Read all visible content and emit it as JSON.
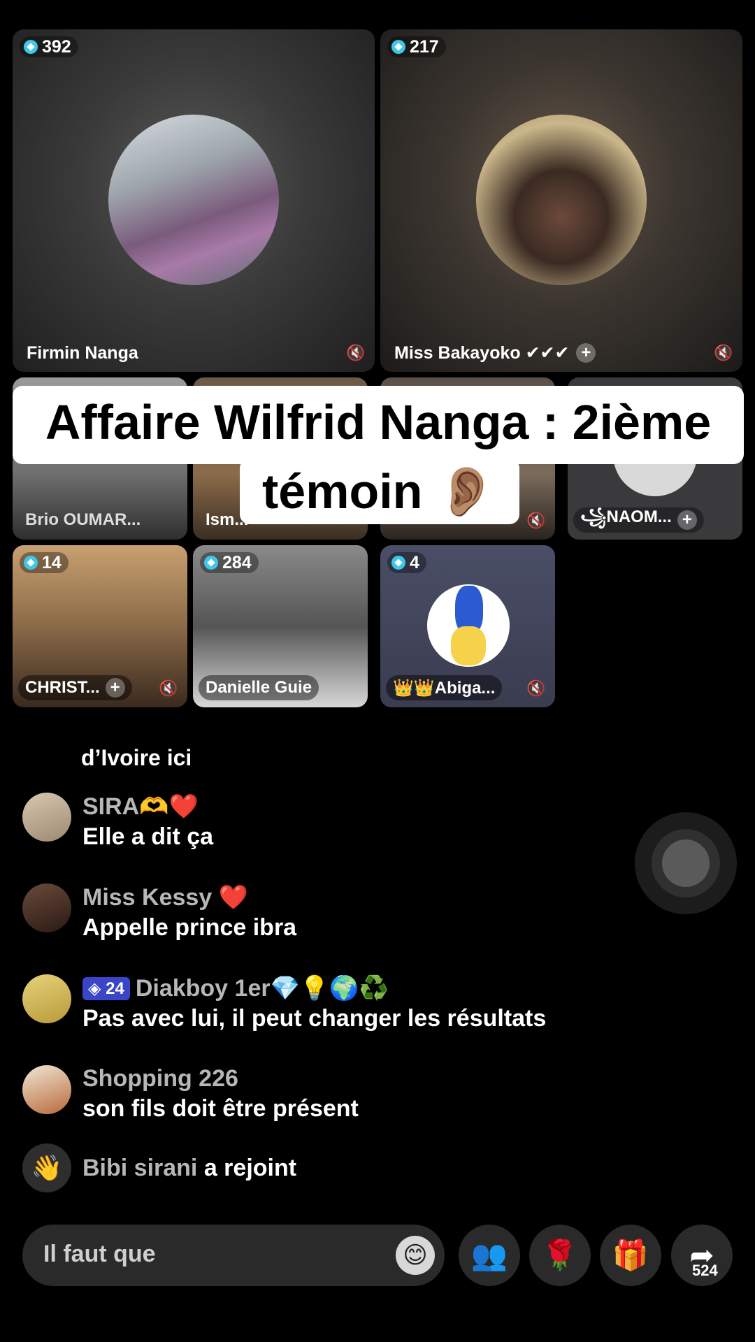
{
  "tiles": [
    {
      "viewers": "392",
      "name": "Firmin Nanga"
    },
    {
      "viewers": "217",
      "name": "Miss Bakayoko ✔✔✔"
    },
    {
      "name": "Brio OUMAR..."
    },
    {
      "name": "Ism..."
    },
    {
      "name": ""
    },
    {
      "name": "꧁NAOM..."
    },
    {
      "viewers": "14",
      "name": "CHRIST..."
    },
    {
      "viewers": "284",
      "name": "Danielle Guie"
    },
    {
      "viewers": "4",
      "name": "👑👑Abiga..."
    }
  ],
  "overlay": {
    "line1": "Affaire Wilfrid Nanga : 2ième",
    "line2": "témoin 👂🏽"
  },
  "chat": {
    "partial_text": "d’Ivoire ici",
    "messages": [
      {
        "user": "SIRA🫶❤️",
        "text": "Elle a dit ça"
      },
      {
        "user": "Miss Kessy ❤️",
        "text": "Appelle prince ibra"
      },
      {
        "level": "24",
        "user": "Diakboy 1er💎💡🌍♻️",
        "text": "Pas avec lui, il peut changer les résultats"
      },
      {
        "user": "Shopping 226",
        "text": "son fils doit être présent"
      }
    ],
    "join": {
      "user": "Bibi sirani",
      "action": "a rejoint"
    }
  },
  "bottom": {
    "input_placeholder": "Il faut que",
    "share_count": "524"
  },
  "icons": {
    "emoji": "😊",
    "guests": "👥",
    "rose": "🌹",
    "gift": "🎁",
    "share": "➦",
    "wave": "👋",
    "mute": "🔇",
    "gem": "gem-icon"
  }
}
